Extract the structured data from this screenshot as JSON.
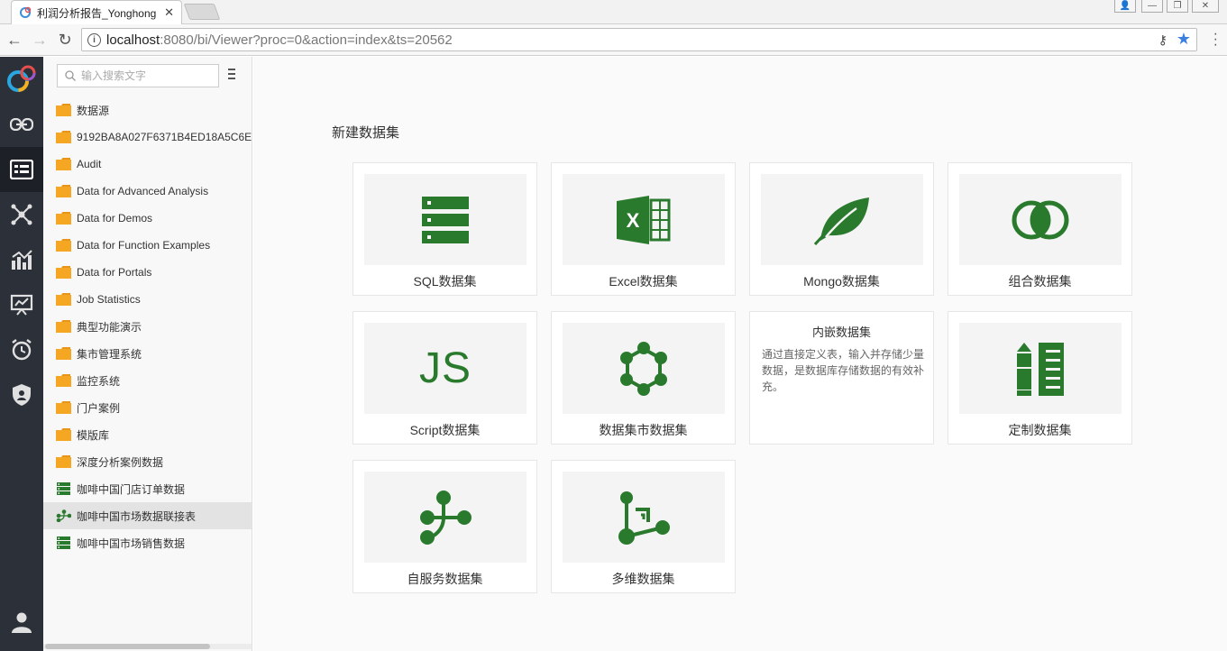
{
  "browser": {
    "tab_title": "利润分析报告_Yonghong",
    "url_host": "localhost",
    "url_path": ":8080/bi/Viewer?proc=0&action=index&ts=20562"
  },
  "tree": {
    "search_placeholder": "输入搜索文字",
    "items": [
      {
        "label": "数据源",
        "icon": "folder-icon"
      },
      {
        "label": "9192BA8A027F6371B4ED18A5C6E",
        "icon": "folder-icon"
      },
      {
        "label": "Audit",
        "icon": "folder-icon"
      },
      {
        "label": "Data for Advanced Analysis",
        "icon": "folder-icon"
      },
      {
        "label": "Data for Demos",
        "icon": "folder-icon"
      },
      {
        "label": "Data for Function Examples",
        "icon": "folder-icon"
      },
      {
        "label": "Data for Portals",
        "icon": "folder-icon"
      },
      {
        "label": "Job Statistics",
        "icon": "folder-icon"
      },
      {
        "label": "典型功能演示",
        "icon": "folder-icon"
      },
      {
        "label": "集市管理系统",
        "icon": "folder-icon"
      },
      {
        "label": "监控系统",
        "icon": "folder-icon"
      },
      {
        "label": "门户案例",
        "icon": "folder-icon"
      },
      {
        "label": "模版库",
        "icon": "folder-icon"
      },
      {
        "label": "深度分析案例数据",
        "icon": "folder-icon"
      },
      {
        "label": "咖啡中国门店订单数据",
        "icon": "table-dataset-icon"
      },
      {
        "label": "咖啡中国市场数据联接表",
        "icon": "join-dataset-icon"
      },
      {
        "label": "咖啡中国市场销售数据",
        "icon": "table-dataset-icon"
      }
    ]
  },
  "main": {
    "heading": "新建数据集",
    "cards": [
      {
        "label": "SQL数据集",
        "icon": "sql-database-icon"
      },
      {
        "label": "Excel数据集",
        "icon": "excel-icon"
      },
      {
        "label": "Mongo数据集",
        "icon": "mongo-leaf-icon"
      },
      {
        "label": "组合数据集",
        "icon": "combine-circles-icon"
      },
      {
        "label": "Script数据集",
        "icon": "js-script-icon"
      },
      {
        "label": "数据集市数据集",
        "icon": "data-mart-icon"
      },
      {
        "label": "内嵌数据集",
        "description": "通过直接定义表，输入并存储少量数据，是数据库存储数据的有效补充。"
      },
      {
        "label": "定制数据集",
        "icon": "custom-pencil-icon"
      },
      {
        "label": "自服务数据集",
        "icon": "self-service-icon"
      },
      {
        "label": "多维数据集",
        "icon": "cube-dataset-icon"
      }
    ]
  },
  "colors": {
    "accent_green": "#2a7a2e",
    "folder_orange": "#f5a623",
    "rail_bg": "#2c3039"
  }
}
